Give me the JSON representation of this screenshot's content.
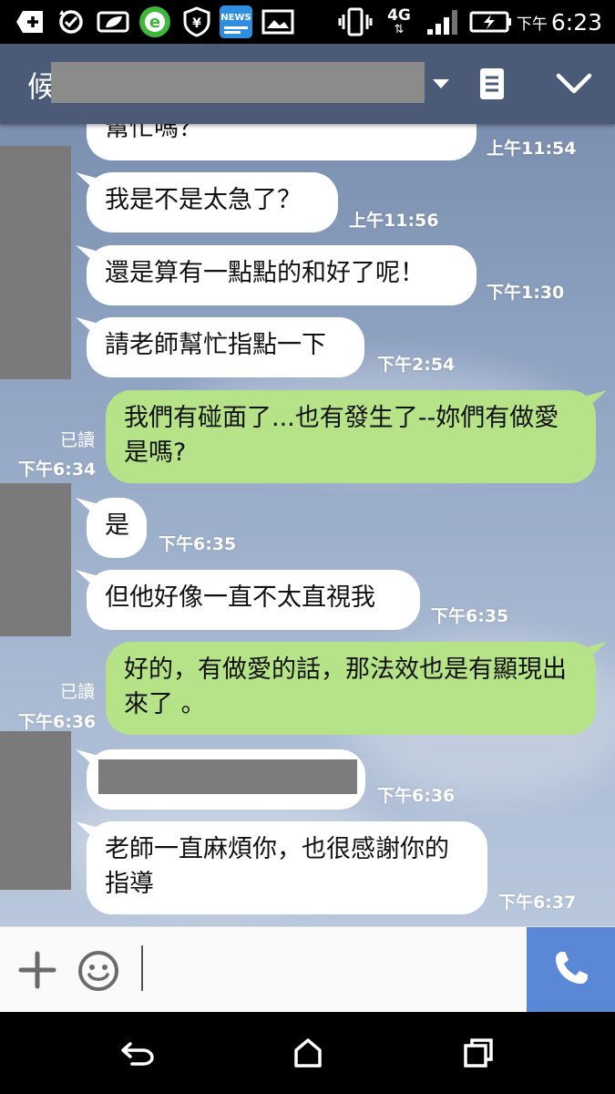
{
  "status_bar": {
    "ampm": "下午",
    "clock": "6:23",
    "network": "4G",
    "news_badge": "NEWS",
    "icons": [
      "add-icon",
      "sync-icon",
      "leaf-icon",
      "browser-e-icon",
      "shield-yuan-icon",
      "news-icon",
      "image-icon",
      "vibrate-icon",
      "network-4g-icon",
      "signal-icon",
      "battery-charging-icon"
    ]
  },
  "header": {
    "title_char": "候",
    "icons": [
      "dropdown-arrow-icon",
      "notes-icon",
      "collapse-chevron-icon"
    ]
  },
  "messages": [
    {
      "side": "in",
      "text": "幫忙嗎？",
      "time": "上午11:54"
    },
    {
      "side": "in",
      "text": "我是不是太急了？",
      "time": "上午11:56"
    },
    {
      "side": "in",
      "text": "還是算有一點點的和好了呢！",
      "time": "下午1:30"
    },
    {
      "side": "in",
      "text": "請老師幫忙指點一下",
      "time": "下午2:54"
    },
    {
      "side": "out",
      "text": "我們有碰面了...也有發生了--妳們有做愛是嗎?",
      "time": "下午6:34",
      "read": "已讀"
    },
    {
      "side": "in",
      "text": "是",
      "time": "下午6:35"
    },
    {
      "side": "in",
      "text": "但他好像一直不太直視我",
      "time": "下午6:35"
    },
    {
      "side": "out",
      "text": "好的，有做愛的話，那法效也是有顯現出來了 。",
      "time": "下午6:36",
      "read": "已讀"
    },
    {
      "side": "in",
      "text": "",
      "redacted": true,
      "time": "下午6:36"
    },
    {
      "side": "in",
      "text": "老師一直麻煩你，也很感謝你的指導",
      "time": "下午6:37"
    }
  ],
  "input_bar": {
    "input_value": "",
    "icons": [
      "plus-icon",
      "emoji-icon",
      "phone-icon"
    ]
  },
  "nav_bar": {
    "icons": [
      "back-icon",
      "home-icon",
      "recents-icon"
    ]
  },
  "colors": {
    "header_bg": "#4a5a77",
    "incoming_bubble": "#ffffff",
    "outgoing_bubble": "#b6e388",
    "call_button": "#5b88d6"
  }
}
